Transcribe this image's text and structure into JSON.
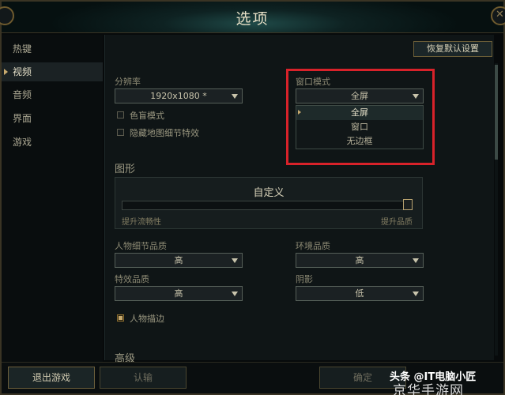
{
  "window": {
    "title": "选项"
  },
  "sidebar": {
    "items": [
      {
        "label": "热键",
        "active": false
      },
      {
        "label": "视频",
        "active": true
      },
      {
        "label": "音频",
        "active": false
      },
      {
        "label": "界面",
        "active": false
      },
      {
        "label": "游戏",
        "active": false
      }
    ]
  },
  "toolbar": {
    "reset_label": "恢复默认设置"
  },
  "resolution": {
    "label": "分辨率",
    "value": "1920x1080 *"
  },
  "window_mode": {
    "label": "窗口模式",
    "value": "全屏",
    "options": [
      "全屏",
      "窗口",
      "无边框"
    ],
    "selected_index": 0
  },
  "checks": {
    "colorblind": {
      "label": "色盲模式",
      "checked": false
    },
    "hide_map_detail": {
      "label": "隐藏地图细节特效",
      "checked": false
    },
    "character_outline": {
      "label": "人物描边",
      "checked": true
    }
  },
  "graphics": {
    "section": "图形",
    "preset": "自定义",
    "slider_value_percent": 100,
    "left_label": "提升流畅性",
    "right_label": "提升品质"
  },
  "quality": {
    "character": {
      "label": "人物细节品质",
      "value": "高"
    },
    "environment": {
      "label": "环境品质",
      "value": "高"
    },
    "effects": {
      "label": "特效品质",
      "value": "高"
    },
    "shadow": {
      "label": "阴影",
      "value": "低"
    }
  },
  "advanced": {
    "section": "高级"
  },
  "bottom": {
    "exit_label": "退出游戏",
    "confirm_label": "认输",
    "ok_label": "确定"
  },
  "watermark": {
    "line1": "头条 @IT电脑小匠",
    "line2": "京华手游网"
  },
  "colors": {
    "accent": "#c8aa6e",
    "highlight": "#d8222a",
    "background": "#0f1516"
  }
}
